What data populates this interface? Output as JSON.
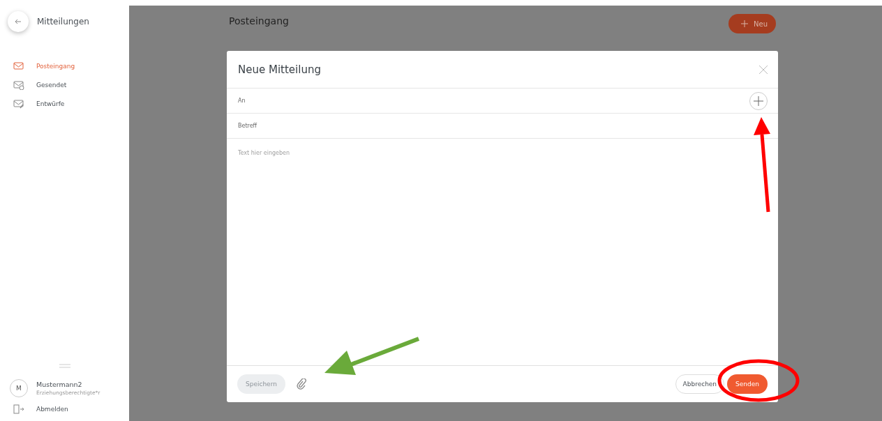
{
  "sidebar": {
    "title": "Mitteilungen",
    "items": [
      {
        "label": "Posteingang",
        "kind": "inbox",
        "selected": true
      },
      {
        "label": "Gesendet",
        "kind": "sent",
        "selected": false
      },
      {
        "label": "Entwürfe",
        "kind": "drafts",
        "selected": false
      }
    ],
    "user": {
      "initial": "M",
      "name": "Mustermann2",
      "role": "Erziehungsberechtigte*r"
    },
    "logout": "Abmelden"
  },
  "main": {
    "title": "Posteingang",
    "new_button": "Neu"
  },
  "dialog": {
    "title": "Neue Mitteilung",
    "fields": [
      {
        "label": "An",
        "kind": "recipient"
      },
      {
        "label": "Betreff",
        "kind": "subject"
      }
    ],
    "body_placeholder": "Text hier eingeben",
    "save_button": {
      "label": "Speichern",
      "disabled": true
    },
    "cancel_button": "Abbrechen",
    "send_button": "Senden"
  }
}
